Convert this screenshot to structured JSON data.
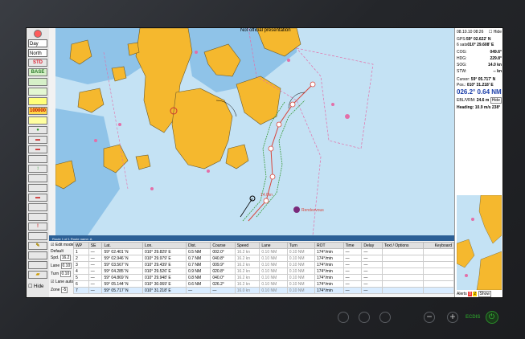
{
  "chart_title": "Not official presentation",
  "toolbar": {
    "mode_select": "Day",
    "orientation_select": "North",
    "buttons": [
      "STD",
      "BASE",
      "100000"
    ],
    "hide_label": "Hide"
  },
  "right_panel": {
    "datetime": "08.10.10  08:26",
    "hide_label": "Hide",
    "gps_label": "GPS:",
    "gps_lat": "59° 02.622' N",
    "gps_lon": "010° 29.608' E",
    "gps_sats": "6 sats",
    "cog_label": "COG:",
    "cog": "049.6°",
    "hdg_label": "HDG:",
    "hdg": "229.8°",
    "sog_label": "SOG:",
    "sog": "14.0 kn",
    "stw_label": "STW:",
    "stw": "-- kn",
    "cursor_label": "Cursor:",
    "cursor_lat": "59° 05.717' N",
    "cursor_lon": "010° 31.218' E",
    "pos_label": "Pos.:",
    "brg_dist": "026.2°  0.64 NM",
    "ebl_label": "EBL/VRM:",
    "ebl_value": "24.6 m",
    "ebl_hide": "Hide",
    "heading_line": "Heading: 10.9 m/s 238°",
    "alerts_label": "Alerts",
    "alerts_count_a": "0",
    "alerts_count_b": "2",
    "alerts_show": "Show"
  },
  "route_panel": {
    "header": "Route   1 of 1   Route name: A",
    "left": {
      "edit_label": "Edit mode",
      "defaults_label": "Default",
      "spd_label": "Spd.",
      "spd_value": "16.2",
      "lane_label": "Lane",
      "lane_value": "0.10",
      "turn_label": "Turn",
      "turn_value": "0.10",
      "lane_auto_label": "Lane auto",
      "zone_label": "Zone",
      "zone_value": "-5"
    },
    "columns": [
      "WP",
      "SE",
      "Lat.",
      "Lon.",
      "Dist.",
      "Course",
      "Speed",
      "Lane",
      "Turn",
      "ROT",
      "Time",
      "Delay",
      "Text / Options",
      "Keyboard"
    ],
    "rows": [
      [
        "1",
        "—",
        "59° 02.401' N",
        "010° 29.829' E",
        "0.5 NM",
        "002.0°",
        "16.2 kn",
        "0.10 NM",
        "0.10 NM",
        "174°/min",
        "—",
        "—",
        "",
        ""
      ],
      [
        "2",
        "—",
        "59° 02.946' N",
        "010° 29.979' E",
        "0.7 NM",
        "040.8°",
        "16.2 kn",
        "0.10 NM",
        "0.10 NM",
        "174°/min",
        "—",
        "—",
        "",
        ""
      ],
      [
        "3",
        "—",
        "59° 03.567' N",
        "010° 29.439' E",
        "0.7 NM",
        "009.9°",
        "16.2 kn",
        "0.10 NM",
        "0.10 NM",
        "174°/min",
        "—",
        "—",
        "",
        ""
      ],
      [
        "4",
        "—",
        "59° 04.285' N",
        "010° 29.526' E",
        "0.9 NM",
        "020.8°",
        "16.2 kn",
        "0.10 NM",
        "0.10 NM",
        "174°/min",
        "—",
        "—",
        "",
        ""
      ],
      [
        "5",
        "—",
        "59° 04.869' N",
        "010° 29.948' E",
        "0.8 NM",
        "040.0°",
        "16.2 kn",
        "0.10 NM",
        "0.10 NM",
        "174°/min",
        "—",
        "—",
        "",
        ""
      ],
      [
        "6",
        "—",
        "59° 05.144' N",
        "010° 30.069' E",
        "0.6 NM",
        "026.2°",
        "16.2 kn",
        "0.10 NM",
        "0.10 NM",
        "174°/min",
        "—",
        "—",
        "",
        ""
      ],
      [
        "7",
        "—",
        "59° 05.717' N",
        "010° 31.218' E",
        "—",
        "—",
        "16.0 kn",
        "0.10 NM",
        "0.10 NM",
        "174°/min",
        "—",
        "—",
        "",
        ""
      ]
    ]
  },
  "chart_labels": {
    "speed_tag": "14.0kn",
    "target_tag": "Rendezvous"
  },
  "hardware": {
    "ecdis_label": "ECDIS",
    "minus": "−",
    "plus": "+"
  },
  "colors": {
    "land": "#f5b82e",
    "sea": "#c4e2f4",
    "shallow": "#8fc3e8",
    "route": "#d8463c",
    "track": "#3a9a3a",
    "ecdis_green": "#2a8a2a"
  }
}
